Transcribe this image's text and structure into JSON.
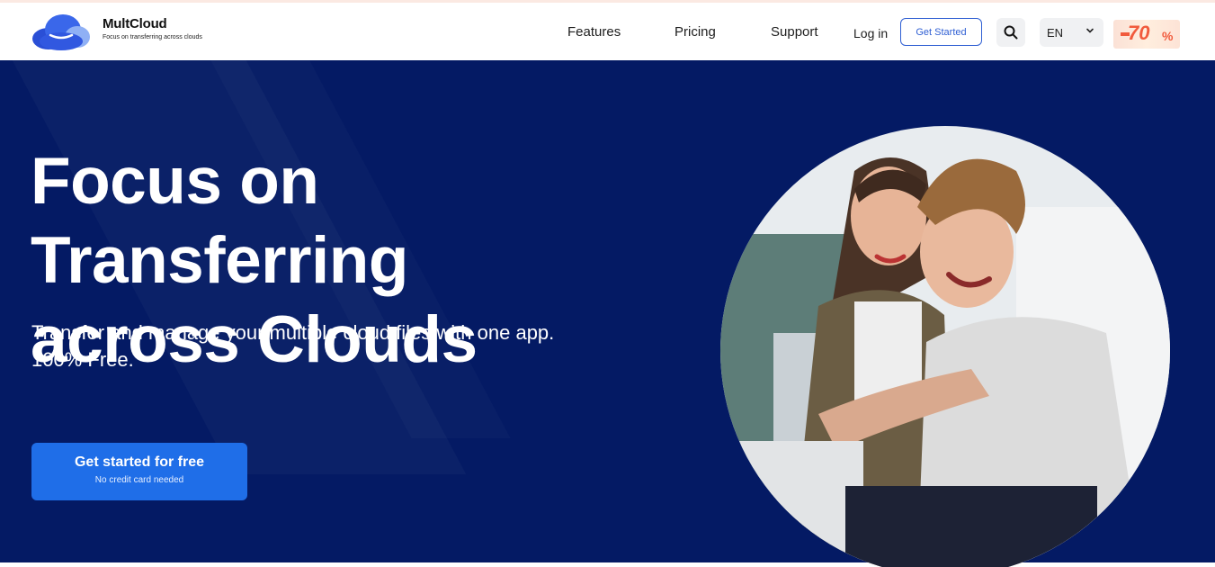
{
  "brand": {
    "name": "MultCloud",
    "tagline": "Focus on transferring across clouds"
  },
  "nav": {
    "features": "Features",
    "pricing": "Pricing",
    "support": "Support",
    "login": "Log in",
    "get_started": "Get Started",
    "language": "EN",
    "promo_number": "70",
    "promo_percent": "%"
  },
  "icons": {
    "search": "search-icon",
    "chevron": "chevron-down-icon",
    "logo": "cloud-logo-icon"
  },
  "hero": {
    "title_line1": "Focus on Transferring",
    "title_line2": "across Clouds",
    "subtitle_line1": "Transfer and manage your multiple cloud files with one app.",
    "subtitle_line2": "100% Free.",
    "cta_label": "Get started for free",
    "cta_sublabel": "No credit card needed"
  },
  "colors": {
    "hero_bg": "#041a64",
    "accent": "#1f6ee8",
    "outline": "#2f5fd3",
    "promo": "#f15a3c"
  }
}
